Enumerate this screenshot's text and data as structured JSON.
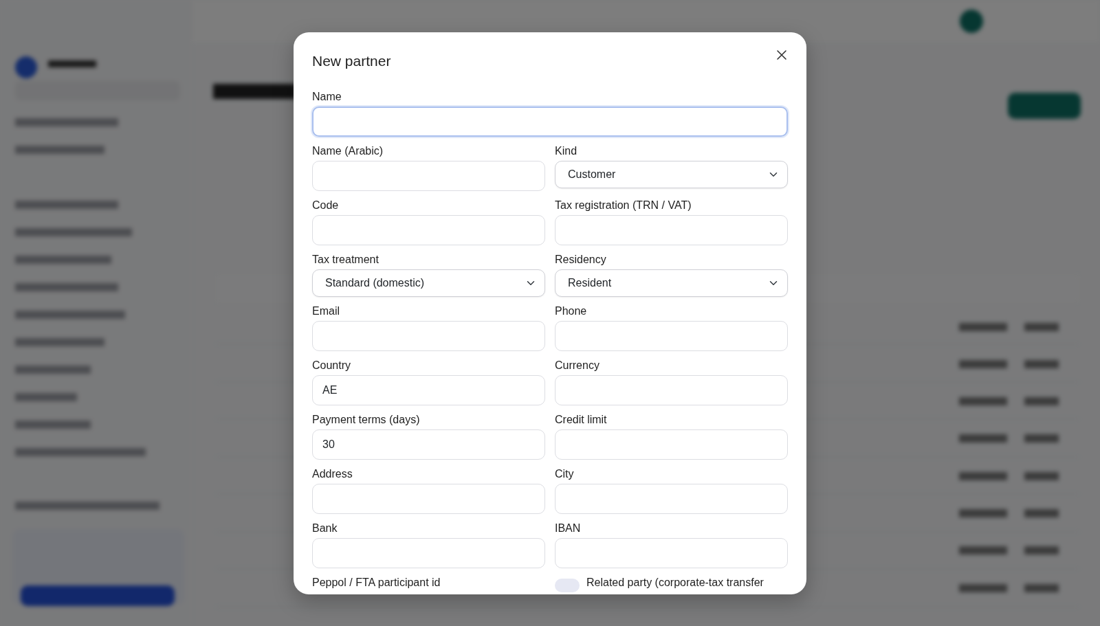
{
  "dialog": {
    "title": "New partner",
    "rows": [
      {
        "fields": [
          {
            "label": "Name",
            "kind": "text",
            "focused": true
          }
        ]
      },
      {
        "fields": [
          {
            "label": "Name (Arabic)",
            "kind": "text",
            "focused": false
          },
          {
            "label": "Kind",
            "kind": "select",
            "value": "Customer",
            "focused": false
          }
        ]
      },
      {
        "fields": [
          {
            "label": "Code",
            "kind": "text",
            "focused": false
          },
          {
            "label": "Tax registration (TRN / VAT)",
            "kind": "text",
            "focused": false
          }
        ]
      },
      {
        "fields": [
          {
            "label": "Tax treatment",
            "kind": "select",
            "value": "Standard (domestic)",
            "focused": false
          },
          {
            "label": "Residency",
            "kind": "select",
            "value": "Resident",
            "focused": false
          }
        ]
      },
      {
        "fields": [
          {
            "label": "Email",
            "kind": "text",
            "focused": false
          },
          {
            "label": "Phone",
            "kind": "text",
            "focused": false
          }
        ]
      },
      {
        "fields": [
          {
            "label": "Country",
            "kind": "text",
            "value": "AE",
            "focused": false
          },
          {
            "label": "Currency",
            "kind": "text",
            "focused": false
          }
        ]
      },
      {
        "fields": [
          {
            "label": "Payment terms (days)",
            "kind": "text",
            "value": "30",
            "focused": false
          },
          {
            "label": "Credit limit",
            "kind": "text",
            "focused": false
          }
        ]
      },
      {
        "fields": [
          {
            "label": "Address",
            "kind": "text",
            "focused": false
          },
          {
            "label": "City",
            "kind": "text",
            "focused": false
          }
        ]
      },
      {
        "fields": [
          {
            "label": "Bank",
            "kind": "text",
            "focused": false
          },
          {
            "label": "IBAN",
            "kind": "text",
            "focused": false
          }
        ]
      },
      {
        "fields": [
          {
            "label": "Peppol / FTA participant id",
            "kind": "label"
          },
          {
            "label": "Related party (corporate-tax transfer",
            "kind": "switch",
            "checked": false
          }
        ]
      }
    ]
  }
}
